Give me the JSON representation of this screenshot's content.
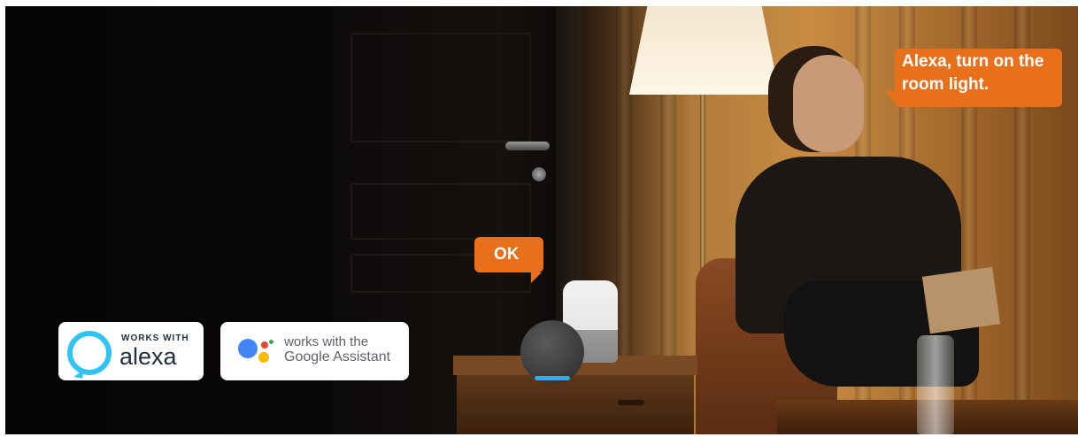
{
  "bubbles": {
    "user_line1": "Alexa, turn on the",
    "user_line2": "room light.",
    "device_reply": "OK"
  },
  "badges": {
    "alexa_works_with": "WORKS WITH",
    "alexa_name": "alexa",
    "google_line1": "works with the",
    "google_line2": "Google Assistant"
  },
  "colors": {
    "bubble": "#e8701a",
    "alexa_blue": "#31c4f3",
    "google_blue": "#4285f4",
    "google_red": "#ea4335",
    "google_yellow": "#fbbc05",
    "google_green": "#34a853"
  },
  "icons": [
    "alexa-logo-icon",
    "google-assistant-logo-icon"
  ]
}
